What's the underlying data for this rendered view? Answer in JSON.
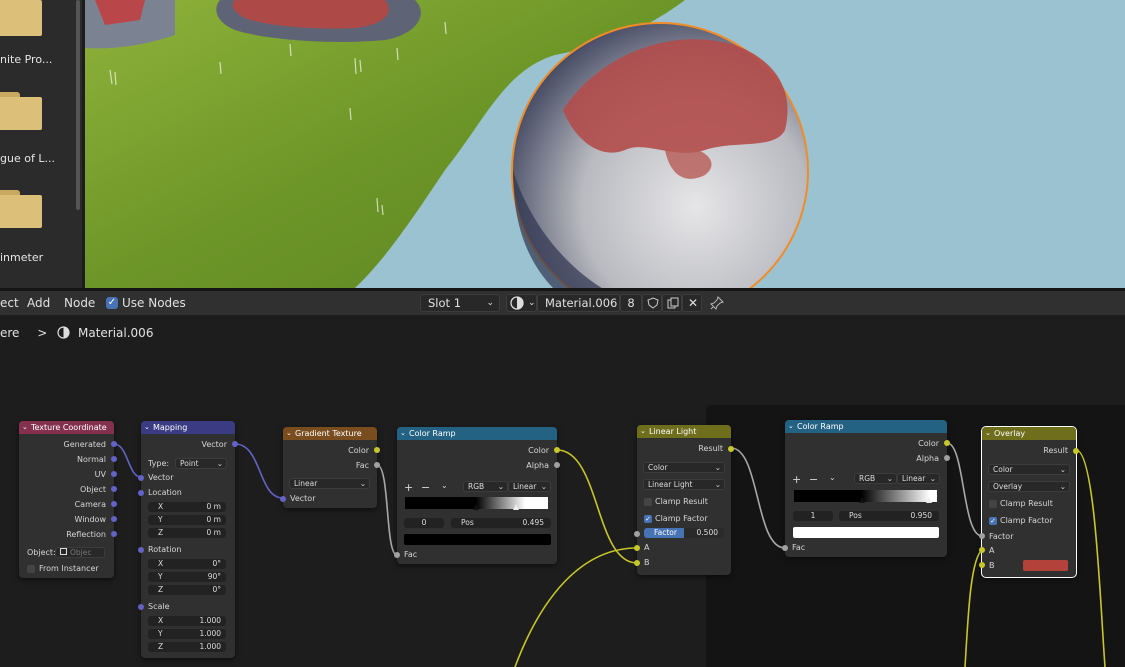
{
  "file_browser": {
    "items": [
      {
        "label": "nite Pro..."
      },
      {
        "label": "gue of L..."
      },
      {
        "label": "inmeter"
      }
    ]
  },
  "header": {
    "menu": [
      "ect",
      "Add",
      "Node"
    ],
    "use_nodes_label": "Use Nodes",
    "slot": "Slot 1",
    "material_name": "Material.006",
    "users": "8"
  },
  "breadcrumb": {
    "parent": "ere",
    "sep": ">",
    "material": "Material.006"
  },
  "nodes": {
    "texcoord": {
      "title": "Texture Coordinate",
      "outputs": [
        "Generated",
        "Normal",
        "UV",
        "Object",
        "Camera",
        "Window",
        "Reflection"
      ],
      "object_label": "Object:",
      "object_placeholder": "Objec",
      "from_instancer": "From Instancer"
    },
    "mapping": {
      "title": "Mapping",
      "output": "Vector",
      "type_label": "Type:",
      "type_value": "Point",
      "vector_in": "Vector",
      "location": {
        "label": "Location",
        "x": "0 m",
        "y": "0 m",
        "z": "0 m"
      },
      "rotation": {
        "label": "Rotation",
        "x": "0°",
        "y": "90°",
        "z": "0°"
      },
      "scale": {
        "label": "Scale",
        "x": "1.000",
        "y": "1.000",
        "z": "1.000"
      },
      "axes": [
        "X",
        "Y",
        "Z"
      ]
    },
    "gradient": {
      "title": "Gradient Texture",
      "outputs": [
        "Color",
        "Fac"
      ],
      "type": "Linear",
      "input": "Vector"
    },
    "ramp1": {
      "title": "Color Ramp",
      "outputs": [
        "Color",
        "Alpha"
      ],
      "mode": "RGB",
      "interp": "Linear",
      "index": "0",
      "pos_label": "Pos",
      "pos_value": "0.495",
      "input": "Fac"
    },
    "linear": {
      "title": "Linear Light",
      "output": "Result",
      "type": "Color",
      "blend": "Linear Light",
      "clamp_result": "Clamp Result",
      "clamp_factor": "Clamp Factor",
      "factor_label": "Factor",
      "factor_value": "0.500",
      "inputs": [
        "A",
        "B"
      ]
    },
    "ramp2": {
      "title": "Color Ramp",
      "outputs": [
        "Color",
        "Alpha"
      ],
      "mode": "RGB",
      "interp": "Linear",
      "index": "1",
      "pos_label": "Pos",
      "pos_value": "0.950",
      "input": "Fac"
    },
    "overlay": {
      "title": "Overlay",
      "output": "Result",
      "type": "Color",
      "blend": "Overlay",
      "clamp_result": "Clamp Result",
      "clamp_factor": "Clamp Factor",
      "inputs": [
        "Factor",
        "A",
        "B"
      ],
      "b_color": "#b2423a"
    }
  },
  "colors": {
    "header_input": "#83314e",
    "header_vector": "#3b3b83",
    "header_texture": "#7a4d1f",
    "header_converter": "#246283",
    "header_color": "#6e6e1d",
    "socket_vector": "#6363c7",
    "socket_color": "#c7c729",
    "socket_float": "#a1a1a1",
    "accent": "#4772b3",
    "selected_outline": "#ff8c00"
  }
}
